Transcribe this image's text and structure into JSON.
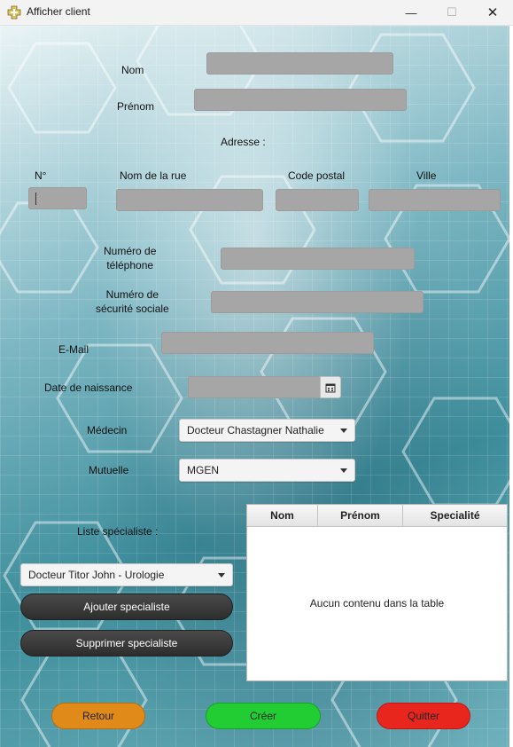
{
  "window": {
    "title": "Afficher client",
    "controls": {
      "minimize": "—",
      "maximize": "☐",
      "close": "✕"
    }
  },
  "form": {
    "nom_label": "Nom",
    "prenom_label": "Prénom",
    "adresse_label": "Adresse :",
    "numero_label": "N°",
    "rue_label": "Nom de la rue",
    "code_postal_label": "Code postal",
    "ville_label": "Ville",
    "telephone_label_1": "Numéro de",
    "telephone_label_2": "téléphone",
    "secu_label_1": "Numéro de",
    "secu_label_2": "sécurité sociale",
    "email_label": "E-Mail",
    "naissance_label": "Date de naissance",
    "medecin_label": "Médecin",
    "medecin_value": "Docteur Chastagner Nathalie",
    "mutuelle_label": "Mutuelle",
    "mutuelle_value": "MGEN",
    "specialiste_label": "Liste spécialiste :",
    "specialiste_value": "Docteur Titor John - Urologie"
  },
  "buttons": {
    "ajouter": "Ajouter specialiste",
    "supprimer": "Supprimer specialiste",
    "retour": "Retour",
    "creer": "Créer",
    "quitter": "Quitter"
  },
  "table": {
    "columns": [
      "Nom",
      "Prénom",
      "Specialité"
    ],
    "empty_text": "Aucun contenu dans la table"
  },
  "colors": {
    "retour": "#e08a1a",
    "creer": "#22cc33",
    "quitter": "#e8261e"
  },
  "icons": {
    "app": "medical-cross-icon",
    "calendar": "calendar-icon"
  }
}
